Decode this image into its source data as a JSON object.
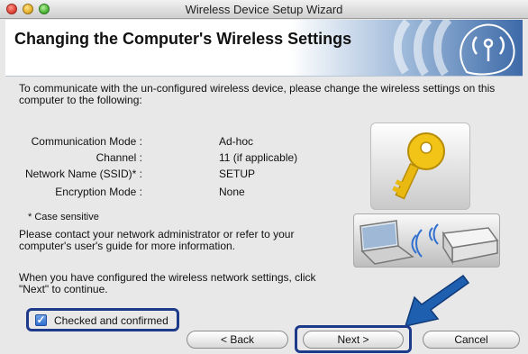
{
  "window": {
    "title": "Wireless Device Setup Wizard"
  },
  "header": {
    "title": "Changing the Computer's Wireless Settings"
  },
  "intro": "To communicate with the un-configured wireless device, please change the wireless settings on this computer to the following:",
  "settings": [
    {
      "label": "Communication Mode :",
      "value": "Ad-hoc"
    },
    {
      "label": "Channel :",
      "value": "11  (if applicable)"
    },
    {
      "label": "Network Name (SSID)* :",
      "value": "SETUP"
    },
    {
      "label": "Encryption Mode :",
      "value": "None"
    }
  ],
  "note": "* Case sensitive",
  "contact": "Please contact your network administrator or refer to your computer's user's guide for more information.",
  "configured": "When you have configured the wireless network settings, click \"Next\" to continue.",
  "checkbox": {
    "label": "Checked and confirmed",
    "checked": true
  },
  "buttons": {
    "back": "< Back",
    "next": "Next >",
    "cancel": "Cancel"
  },
  "colors": {
    "highlight": "#1e3a8a",
    "banner_accent": "#3d6aa8",
    "arrow": "#1f5fb0"
  }
}
